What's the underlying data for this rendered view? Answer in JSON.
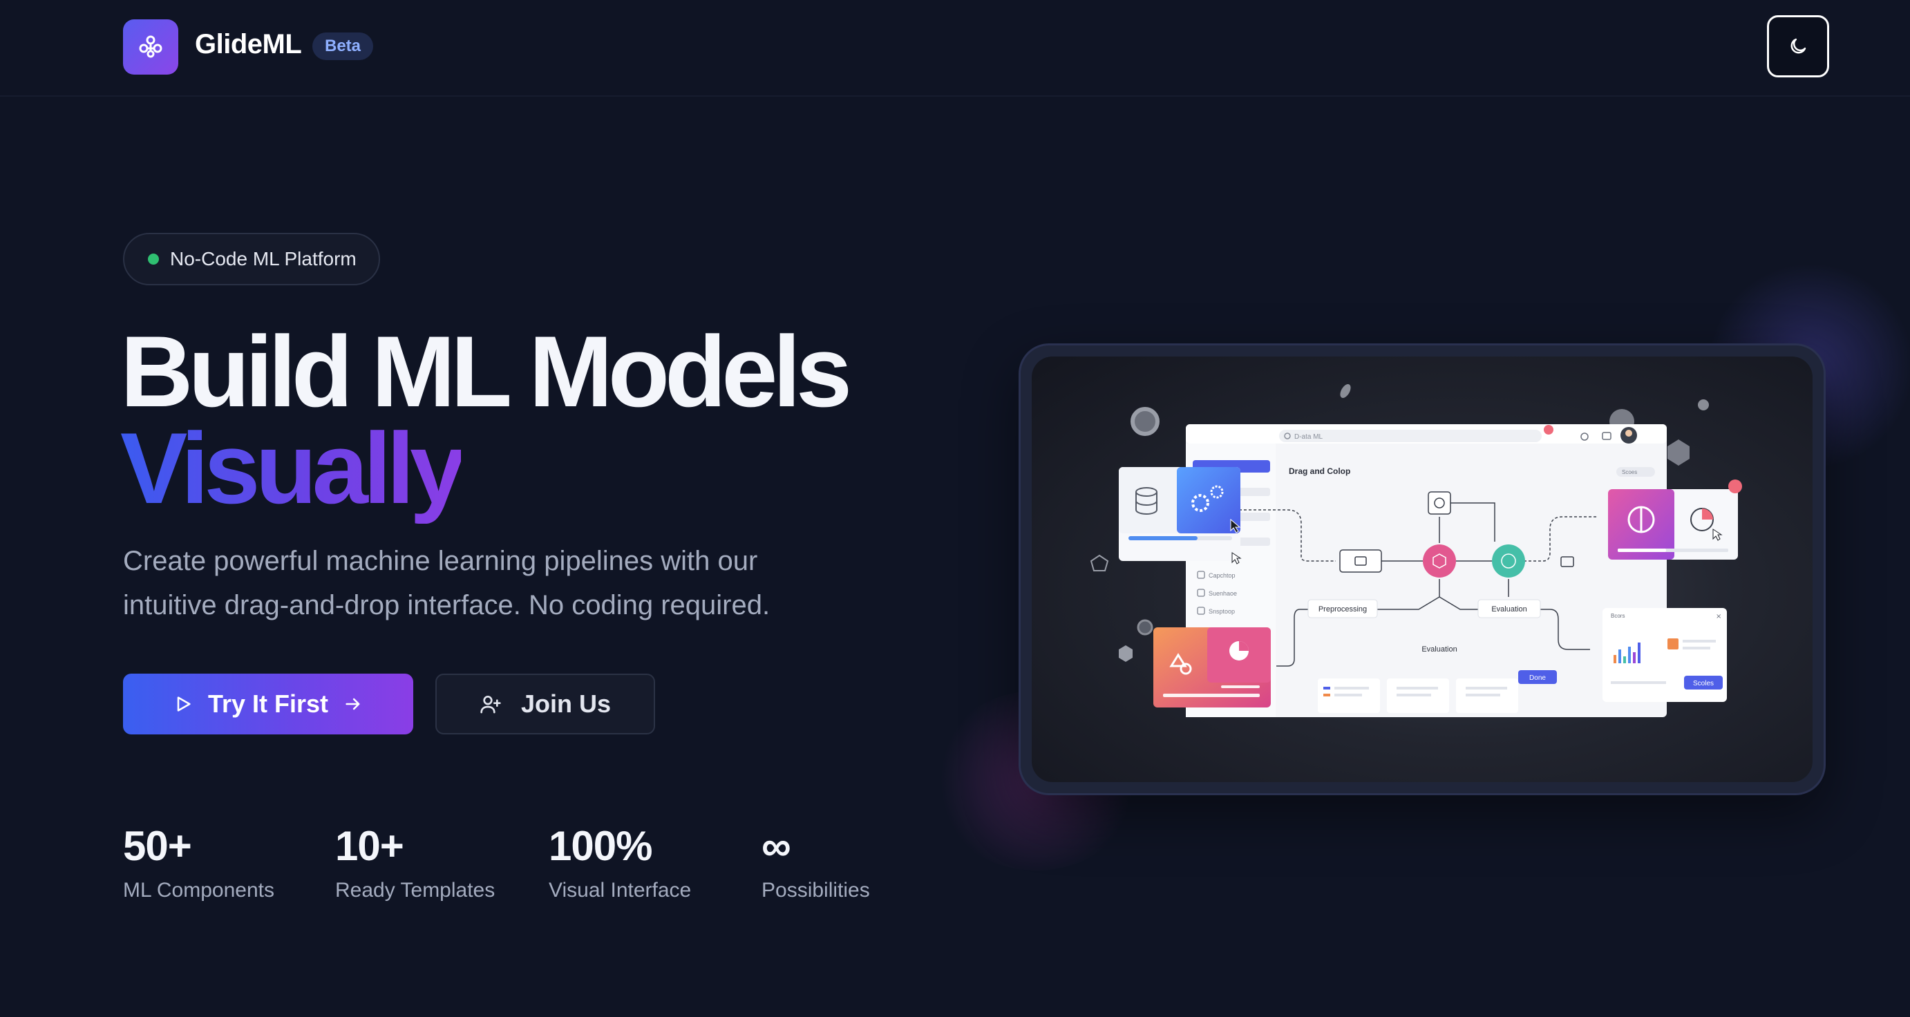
{
  "header": {
    "brand": "GlideML",
    "badge": "Beta",
    "logo_icon": "network-logo-icon",
    "theme_icon": "moon-icon"
  },
  "hero": {
    "pill": "No-Code ML Platform",
    "title_line1": "Build ML Models",
    "title_line2": "Visually",
    "subtitle": "Create powerful machine learning pipelines with our intuitive drag-and-drop interface. No coding required.",
    "primary_button": "Try It First",
    "secondary_button": "Join Us"
  },
  "stats": [
    {
      "value": "50+",
      "label": "ML Components"
    },
    {
      "value": "10+",
      "label": "Ready Templates"
    },
    {
      "value": "100%",
      "label": "Visual Interface"
    },
    {
      "value": "∞",
      "label": "Possibilities"
    }
  ],
  "showcase": {
    "search": "D-ata ML",
    "panel_title": "Drag and Colop",
    "chip": "Scoes",
    "node_preprocessing": "Preprocessing",
    "node_evaluation": "Evaluation",
    "node_evaluation2": "Evaluation",
    "done_button": "Done",
    "sidebar_items": [
      "Capchtop",
      "Suenhaoe",
      "Snsptoop"
    ],
    "scores_title": "Bcors",
    "scores_button": "Scoles"
  },
  "colors": {
    "background": "#0f1424",
    "accent_start": "#3b5bf0",
    "accent_end": "#8a3ee6",
    "status_dot": "#2fbf71"
  }
}
